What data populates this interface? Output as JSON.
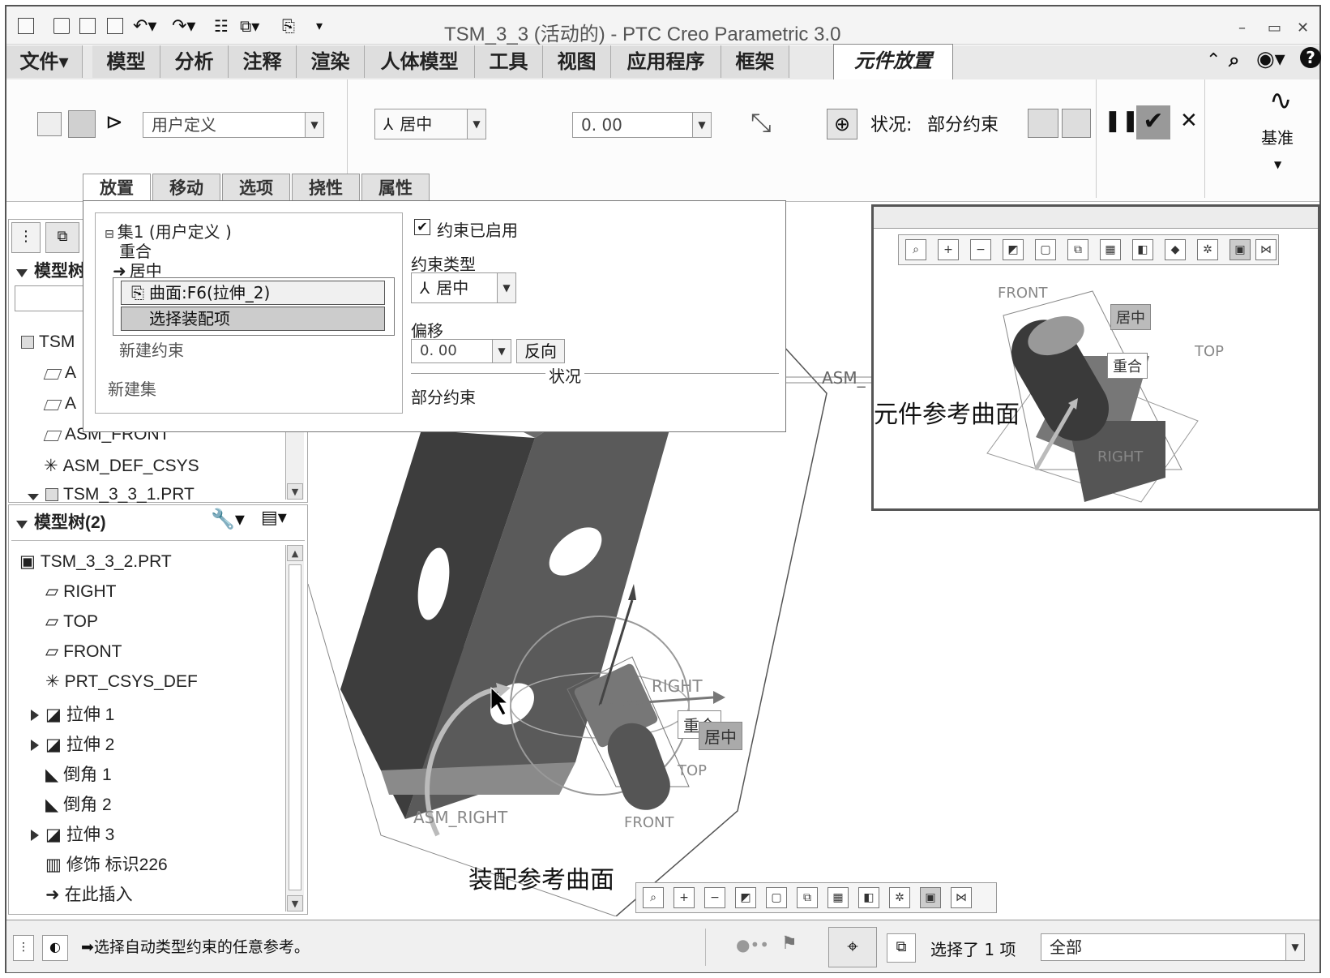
{
  "window": {
    "title": "TSM_3_3 (活动的) - PTC Creo Parametric 3.0",
    "controls": [
      "–",
      "▭",
      "✕"
    ]
  },
  "menu_tabs": [
    "文件▾",
    "模型",
    "分析",
    "注释",
    "渲染",
    "人体模型",
    "工具",
    "视图",
    "应用程序",
    "框架",
    "元件放置"
  ],
  "ribbon": {
    "constraint_set_combo": "用户定义",
    "constraint_type_combo": "居中",
    "offset_combo": "0. 00",
    "status_label": "状况:",
    "status_value": "部分约束",
    "datum_label": "基准"
  },
  "sub_tabs": [
    "放置",
    "移动",
    "选项",
    "挠性",
    "属性"
  ],
  "placement_panel": {
    "set_header": "集1 (用户定义 )",
    "items": [
      "重合",
      "居中"
    ],
    "ref_surface": "曲面:F6(拉伸_2)",
    "select_assembly_item": "选择装配项",
    "new_constraint": "新建约束",
    "new_set": "新建集",
    "constraint_enabled": "约束已启用",
    "constraint_type_label": "约束类型",
    "constraint_type_value": "居中",
    "offset_label": "偏移",
    "offset_value": "0. 00",
    "reverse_button": "反向",
    "status_group_label": "状况",
    "status_value": "部分约束"
  },
  "upper_tree": {
    "header": "模型树",
    "items": [
      "TSM",
      "A",
      "A",
      "ASM_FRONT",
      "ASM_DEF_CSYS",
      "TSM_3_3_1.PRT"
    ]
  },
  "model_tree": {
    "header": "模型树(2)",
    "items": [
      {
        "label": "TSM_3_3_2.PRT",
        "icon": "part-icon",
        "expand": false
      },
      {
        "label": "RIGHT",
        "icon": "datum-plane-icon",
        "expand": false
      },
      {
        "label": "TOP",
        "icon": "datum-plane-icon",
        "expand": false
      },
      {
        "label": "FRONT",
        "icon": "datum-plane-icon",
        "expand": false
      },
      {
        "label": "PRT_CSYS_DEF",
        "icon": "csys-icon",
        "expand": false
      },
      {
        "label": "拉伸 1",
        "icon": "extrude-icon",
        "expand": true
      },
      {
        "label": "拉伸 2",
        "icon": "extrude-icon",
        "expand": true
      },
      {
        "label": "倒角 1",
        "icon": "chamfer-icon",
        "expand": false
      },
      {
        "label": "倒角 2",
        "icon": "chamfer-icon",
        "expand": false
      },
      {
        "label": "拉伸 3",
        "icon": "extrude-icon",
        "expand": true
      },
      {
        "label": "修饰 标识226",
        "icon": "cosmetic-icon",
        "expand": false
      },
      {
        "label": "在此插入",
        "icon": "insert-arrow-icon",
        "expand": false
      }
    ]
  },
  "viewport": {
    "labels": {
      "asm_label": "ASM_",
      "asm_right": "ASM_RIGHT",
      "right": "RIGHT",
      "top": "TOP",
      "front": "FRONT",
      "coincident": "重合",
      "center": "居中"
    },
    "caption_assembly_surface": "装配参考曲面"
  },
  "preview": {
    "labels": {
      "front": "FRONT",
      "center": "居中",
      "top": "TOP",
      "coincident": "重合",
      "right": "RIGHT"
    },
    "caption_component_surface": "元件参考曲面"
  },
  "statusbar": {
    "message": "➡选择自动类型约束的任意参考。",
    "selected_text": "选择了 1 项",
    "filter_value": "全部"
  }
}
